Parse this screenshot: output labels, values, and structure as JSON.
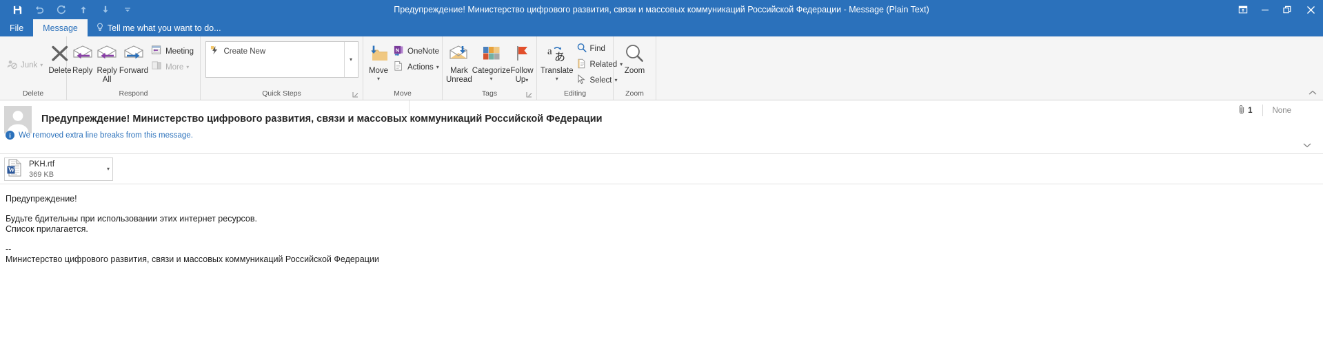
{
  "window": {
    "title": "Предупреждение! Министерство цифрового развития, связи и массовых коммуникаций Российской Федерации - Message (Plain Text)",
    "accent_color": "#2b71bb",
    "quick_access": [
      {
        "name": "save-icon",
        "label": "Save"
      },
      {
        "name": "undo-icon",
        "label": "Undo"
      },
      {
        "name": "redo-icon",
        "label": "Redo"
      },
      {
        "name": "previous-item-icon",
        "label": "Previous Item"
      },
      {
        "name": "next-item-icon",
        "label": "Next Item"
      },
      {
        "name": "customize-quick-access-toolbar-icon",
        "label": "Customize Quick Access Toolbar"
      }
    ],
    "controls": [
      {
        "name": "ribbon-display-options-icon",
        "label": "Ribbon Display Options"
      },
      {
        "name": "minimize-icon",
        "label": "Minimize"
      },
      {
        "name": "restore-icon",
        "label": "Restore Down"
      },
      {
        "name": "close-icon",
        "label": "Close"
      }
    ]
  },
  "tabs": {
    "file": "File",
    "message": "Message",
    "tell_me": "Tell me what you want to do...",
    "tell_me_icon": "lightbulb-icon"
  },
  "ribbon": {
    "groups": [
      {
        "label": "Delete",
        "launcher": false
      },
      {
        "label": "Respond",
        "launcher": false
      },
      {
        "label": "Quick Steps",
        "launcher": true
      },
      {
        "label": "Move",
        "launcher": false
      },
      {
        "label": "Tags",
        "launcher": true
      },
      {
        "label": "Editing",
        "launcher": false
      },
      {
        "label": "Zoom",
        "launcher": false
      }
    ],
    "delete": {
      "junk": "Junk",
      "delete": "Delete"
    },
    "respond": {
      "reply": "Reply",
      "reply_all_line1": "Reply",
      "reply_all_line2": "All",
      "forward": "Forward",
      "meeting": "Meeting",
      "more": "More"
    },
    "quick_steps": {
      "create_new": "Create New"
    },
    "move": {
      "move": "Move",
      "onenote": "OneNote",
      "actions": "Actions"
    },
    "tags": {
      "mark_unread_line1": "Mark",
      "mark_unread_line2": "Unread",
      "categorize": "Categorize",
      "follow_up_line1": "Follow",
      "follow_up_line2": "Up"
    },
    "editing": {
      "translate": "Translate",
      "find": "Find",
      "related": "Related",
      "select": "Select"
    },
    "zoom": {
      "zoom": "Zoom"
    },
    "collapse_icon": "chevron-up-icon"
  },
  "message": {
    "subject": "Предупреждение! Министерство цифрового развития, связи и массовых коммуникаций Российской Федерации",
    "info_notice": "We removed extra line breaks from this message.",
    "attachment_count": "1",
    "sensitivity": "None",
    "expand_icon": "chevron-down-icon",
    "attachment": {
      "name": "PKH.rtf",
      "size": "369 KB",
      "icon": "word-document-icon"
    },
    "body": [
      "Предупреждение!",
      "",
      "Будьте бдительны при использовании этих интернет ресурсов.",
      "Список прилагается.",
      "",
      "--",
      "Министерство цифрового развития, связи и массовых коммуникаций Российской Федерации"
    ]
  }
}
